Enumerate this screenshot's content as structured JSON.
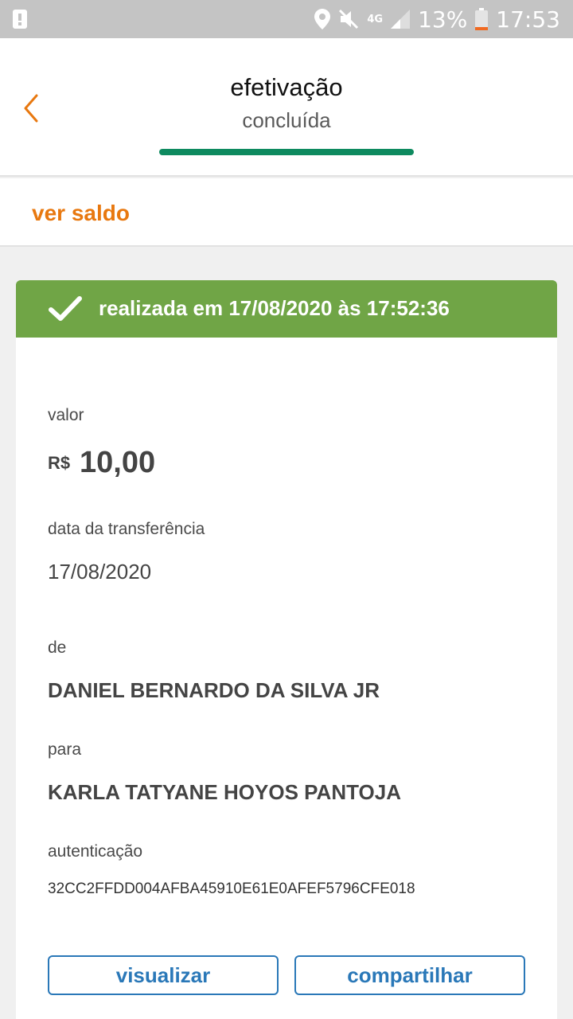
{
  "status_bar": {
    "battery": "13%",
    "time": "17:53",
    "network": "4G",
    "icons": [
      "alert-icon",
      "location-icon",
      "mute-icon",
      "signal-icon",
      "battery-icon"
    ]
  },
  "header": {
    "title": "efetivação",
    "subtitle": "concluída",
    "progress": 1.0,
    "accent_color": "#0e8a5f"
  },
  "saldo": {
    "label": "ver saldo",
    "color": "#e8780f"
  },
  "receipt": {
    "banner_text": "realizada em 17/08/2020 às 17:52:36",
    "banner_color": "#70a546",
    "amount_label": "valor",
    "currency": "R$",
    "amount": "10,00",
    "date_label": "data da transferência",
    "date": "17/08/2020",
    "from_label": "de",
    "from_name": "DANIEL BERNARDO DA SILVA JR",
    "to_label": "para",
    "to_name": "KARLA TATYANE HOYOS PANTOJA",
    "auth_label": "autenticação",
    "auth_code": "32CC2FFDD004AFBA45910E61E0AFEF5796CFE018"
  },
  "actions": {
    "view_label": "visualizar",
    "share_label": "compartilhar",
    "color": "#2a78b8"
  }
}
